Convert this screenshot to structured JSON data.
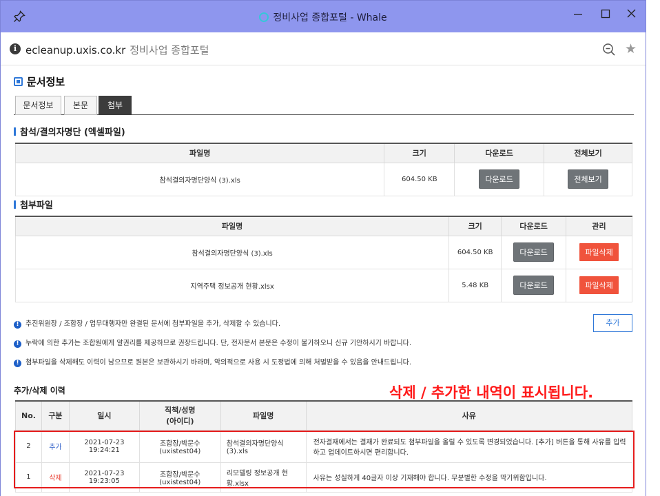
{
  "browser": {
    "title": "정비사업 종합포털 - Whale",
    "url": "ecleanup.uxis.co.kr",
    "site_name": "정비사업 종합포털"
  },
  "page": {
    "heading": "문서정보",
    "tabs": [
      "문서정보",
      "본문",
      "첨부"
    ],
    "active_tab": "첨부"
  },
  "attendance_section": {
    "title": "참석/결의자명단 (엑셀파일)",
    "headers": [
      "파일명",
      "크기",
      "다운로드",
      "전체보기"
    ],
    "rows": [
      {
        "file": "참석결의자명단양식 (3).xls",
        "size": "604.50 KB",
        "download": "다운로드",
        "view": "전체보기"
      }
    ]
  },
  "attachment_section": {
    "title": "첨부파일",
    "headers": [
      "파일명",
      "크기",
      "다운로드",
      "관리"
    ],
    "rows": [
      {
        "file": "참석결의자명단양식 (3).xls",
        "size": "604.50 KB",
        "download": "다운로드",
        "manage": "파일삭제"
      },
      {
        "file": "지역주택 정보공개 현황.xlsx",
        "size": "5.48 KB",
        "download": "다운로드",
        "manage": "파일삭제"
      }
    ]
  },
  "notices": [
    "추진위원장 / 조합장 / 업무대행자만 완결된 문서에 첨부파일을 추가, 삭제할 수 있습니다.",
    "누락에 의한 추가는 조합원에게 알권리를 제공하므로 권장드립니다. 단, 전자문서 본문은 수정이 불가하오니 신규 기안하시기 바랍니다.",
    "첨부파일을 삭제해도 이력이 남으므로 원본은 보관하시기 바라며, 악의적으로 사용 시 도정법에 의해 처벌받을 수 있음을 안내드립니다."
  ],
  "add_button": "추가",
  "history_section": {
    "title": "추가/삭제 이력",
    "annotation": "삭제 / 추가한 내역이 표시됩니다.",
    "headers": [
      "No.",
      "구분",
      "일시",
      "직책/성명",
      "(아이디)",
      "파일명",
      "사유"
    ],
    "rows": [
      {
        "no": "2",
        "kind": "추가",
        "date": "2021-07-23",
        "time": "19:24:21",
        "person": "조합장/박문수",
        "id": "(uxistest04)",
        "file_line1": "참석결의자명단양식",
        "file_line2": "(3).xls",
        "reason": "전자결재에서는 결재가 완료되도 첨부파일을 올릴 수 있도록 변경되었습니다. [추가] 버튼을 통해 사유를 입력하고 업데이트하시면 편리합니다."
      },
      {
        "no": "1",
        "kind": "삭제",
        "date": "2021-07-23",
        "time": "19:23:05",
        "person": "조합장/박문수",
        "id": "(uxistest04)",
        "file_line1": "리모델링 정보공개 현",
        "file_line2": "황.xlsx",
        "reason": "사유는 성실하게 40글자 이상 기재해야 합니다. 무분별한 수정을 막기위함입니다."
      }
    ]
  },
  "colors": {
    "titlebar": "#8e96ee",
    "accent_blue": "#2f78d8",
    "delete_red": "#f0533c",
    "annotation_red": "#ff1a1a"
  }
}
